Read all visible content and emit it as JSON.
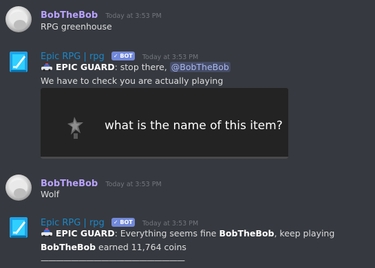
{
  "messages": [
    {
      "author": "BobTheBob",
      "timestamp": "Today at 3:53 PM",
      "text": "RPG greenhouse"
    },
    {
      "author": "Epic RPG | rpg",
      "badge": "✓ BOT",
      "timestamp": "Today at 3:53 PM",
      "line1_bold": "EPIC GUARD",
      "line1_text": ": stop there, ",
      "line1_mention": "@BobTheBob",
      "line2": "We have to check you are actually playing",
      "image_question": "what is the name of this item?"
    },
    {
      "author": "BobTheBob",
      "timestamp": "Today at 3:53 PM",
      "text": "Wolf"
    },
    {
      "author": "Epic RPG | rpg",
      "badge": "✓ BOT",
      "timestamp": "Today at 3:53 PM",
      "line1_bold": "EPIC GUARD",
      "line1_text": ": Everything seems fine ",
      "line1_bold2": "BobTheBob",
      "line1_text2": ", keep playing",
      "line2_bold": "BobTheBob",
      "line2_text": " earned 11,764 coins",
      "line3": "———————————————————"
    }
  ],
  "icons": {
    "user_avatar": "polar-bear-avatar",
    "bot_avatar": "sword-avatar",
    "police_car": "police-car-icon",
    "item": "wolf-skin-item"
  },
  "colors": {
    "background": "#36393f",
    "username_user": "#b9a2ff",
    "username_bot": "#1a87c9",
    "bot_badge": "#7289da",
    "mention": "#a9b8f0"
  }
}
